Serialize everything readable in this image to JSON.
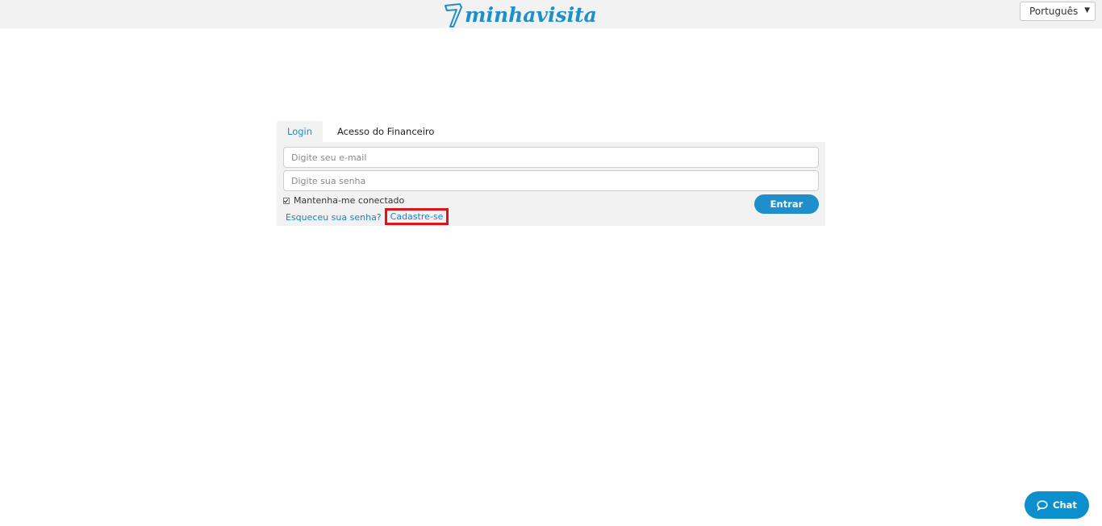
{
  "header": {
    "logo_text": "minhavisita",
    "language": {
      "selected": "Português"
    }
  },
  "tabs": [
    {
      "label": "Login",
      "active": true
    },
    {
      "label": "Acesso do Financeiro",
      "active": false
    }
  ],
  "form": {
    "email_placeholder": "Digite seu e-mail",
    "password_placeholder": "Digite sua senha",
    "remember_label": "Mantenha-me conectado",
    "remember_checked": true,
    "forgot_link": "Esqueceu sua senha?",
    "signup_link": "Cadastre-se",
    "submit_label": "Entrar"
  },
  "chat": {
    "label": "Chat"
  },
  "colors": {
    "brand_blue": "#1e90c8",
    "highlight_red": "#e0131b",
    "panel_bg": "#f2f2f3"
  },
  "icons": [
    "logo-mark-icon",
    "chevron-down-icon",
    "checkbox-checked-icon",
    "chat-bubble-icon"
  ]
}
